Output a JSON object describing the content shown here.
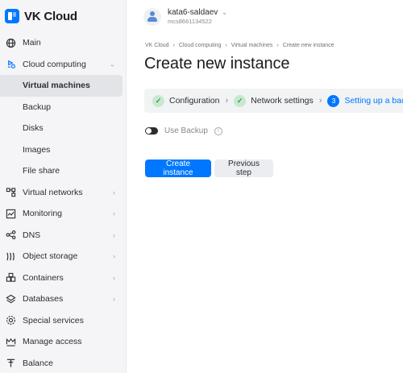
{
  "app": {
    "logo_text": "VK Cloud"
  },
  "sidebar": {
    "items": [
      {
        "label": "Main",
        "icon": "globe-icon"
      },
      {
        "label": "Cloud computing",
        "icon": "cloud-computing-icon",
        "has_chevron": true,
        "expanded": true
      },
      {
        "label": "Virtual machines",
        "sub": true,
        "active": true
      },
      {
        "label": "Backup",
        "sub": true
      },
      {
        "label": "Disks",
        "sub": true
      },
      {
        "label": "Images",
        "sub": true
      },
      {
        "label": "File share",
        "sub": true
      },
      {
        "label": "Virtual networks",
        "icon": "network-icon",
        "has_chevron": true
      },
      {
        "label": "Monitoring",
        "icon": "monitoring-icon",
        "has_chevron": true
      },
      {
        "label": "DNS",
        "icon": "dns-icon",
        "has_chevron": true
      },
      {
        "label": "Object storage",
        "icon": "object-storage-icon",
        "has_chevron": true
      },
      {
        "label": "Containers",
        "icon": "containers-icon",
        "has_chevron": true
      },
      {
        "label": "Databases",
        "icon": "databases-icon",
        "has_chevron": true
      },
      {
        "label": "Special services",
        "icon": "settings-icon"
      },
      {
        "label": "Manage access",
        "icon": "crown-icon"
      },
      {
        "label": "Balance",
        "icon": "balance-icon"
      }
    ]
  },
  "header": {
    "user_name": "kata6-saldaev",
    "user_id": "mcs8661134522"
  },
  "breadcrumb": [
    "VK Cloud",
    "Cloud computing",
    "Virtual machines",
    "Create new instance"
  ],
  "page_title": "Create new instance",
  "steps": [
    {
      "label": "Configuration",
      "state": "done"
    },
    {
      "label": "Network settings",
      "state": "done"
    },
    {
      "label": "Setting up a backup",
      "state": "current",
      "number": "3"
    }
  ],
  "backup": {
    "label": "Use Backup",
    "enabled": false
  },
  "buttons": {
    "create": "Create instance",
    "previous": "Previous step"
  },
  "colors": {
    "accent": "#0077ff",
    "success": "#2f9e47",
    "sidebar_bg": "#f5f5f7"
  }
}
